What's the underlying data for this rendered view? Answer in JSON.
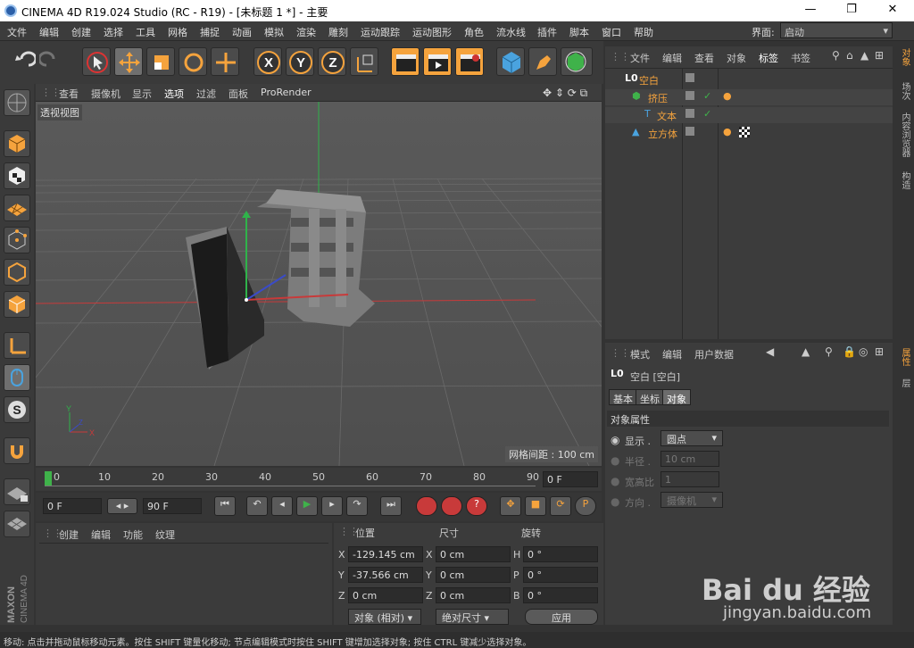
{
  "app": {
    "title": "CINEMA 4D R19.024 Studio (RC - R19) - [未标题 1 *] - 主要",
    "layout_label": "界面:",
    "layout_value": "启动"
  },
  "window_buttons": {
    "minimize": "—",
    "restore": "❐",
    "close": "✕"
  },
  "menus": [
    "文件",
    "编辑",
    "创建",
    "选择",
    "工具",
    "网格",
    "捕捉",
    "动画",
    "模拟",
    "渲染",
    "雕刻",
    "运动跟踪",
    "运动图形",
    "角色",
    "流水线",
    "插件",
    "脚本",
    "窗口",
    "帮助"
  ],
  "viewport": {
    "menu": [
      "查看",
      "摄像机",
      "显示",
      "选项",
      "过滤",
      "面板",
      "ProRender"
    ],
    "label": "透视视图",
    "grid_spacing": "网格间距 : 100 cm"
  },
  "timeline": {
    "ticks": [
      "0",
      "10",
      "20",
      "30",
      "40",
      "50",
      "60",
      "70",
      "80",
      "90"
    ],
    "current_frame": "0 F"
  },
  "transport": {
    "start": "0 F",
    "end": "90 F"
  },
  "material": {
    "tabs": [
      "创建",
      "编辑",
      "功能",
      "纹理"
    ]
  },
  "coords": {
    "headers": [
      "位置",
      "尺寸",
      "旋转"
    ],
    "rows": [
      {
        "axis": "X",
        "pos": "-129.145 cm",
        "size_axis": "X",
        "size": "0 cm",
        "rot_axis": "H",
        "rot": "0 °"
      },
      {
        "axis": "Y",
        "pos": "-37.566 cm",
        "size_axis": "Y",
        "size": "0 cm",
        "rot_axis": "P",
        "rot": "0 °"
      },
      {
        "axis": "Z",
        "pos": "0 cm",
        "size_axis": "Z",
        "size": "0 cm",
        "rot_axis": "B",
        "rot": "0 °"
      }
    ],
    "mode": "对象 (相对)",
    "size_mode": "绝对尺寸",
    "apply": "应用"
  },
  "objects": {
    "menu": [
      "文件",
      "编辑",
      "查看",
      "对象",
      "标签",
      "书签"
    ],
    "items": [
      {
        "name": "空白",
        "indent": 0
      },
      {
        "name": "挤压",
        "indent": 1
      },
      {
        "name": "文本",
        "indent": 2
      },
      {
        "name": "立方体",
        "indent": 1
      }
    ]
  },
  "attributes": {
    "menu": [
      "模式",
      "编辑",
      "用户数据"
    ],
    "title": "空白 [空白]",
    "tabs": [
      "基本",
      "坐标",
      "对象"
    ],
    "section": "对象属性",
    "props": [
      {
        "label": "显示 .",
        "value": "圆点"
      },
      {
        "label": "半径 .",
        "value": "10 cm"
      },
      {
        "label": "宽高比",
        "value": "1"
      },
      {
        "label": "方向 .",
        "value": "摄像机"
      }
    ]
  },
  "right_tabs": [
    "对象",
    "场次",
    "内容浏览器",
    "构造"
  ],
  "right_tabs2": [
    "属性",
    "层"
  ],
  "brand": {
    "maxon": "MAXON",
    "c4d": "CINEMA 4D"
  },
  "status": "移动: 点击并拖动鼠标移动元素。按住 SHIFT 键量化移动; 节点编辑模式时按住 SHIFT 键增加选择对象; 按住 CTRL 键减少选择对象。",
  "watermark": {
    "brand": "Bai du 经验",
    "url": "jingyan.baidu.com"
  },
  "colors": {
    "accent": "#f5a33d",
    "viewport_bg": "#5c5c5c",
    "panel": "#3c3c3c"
  }
}
